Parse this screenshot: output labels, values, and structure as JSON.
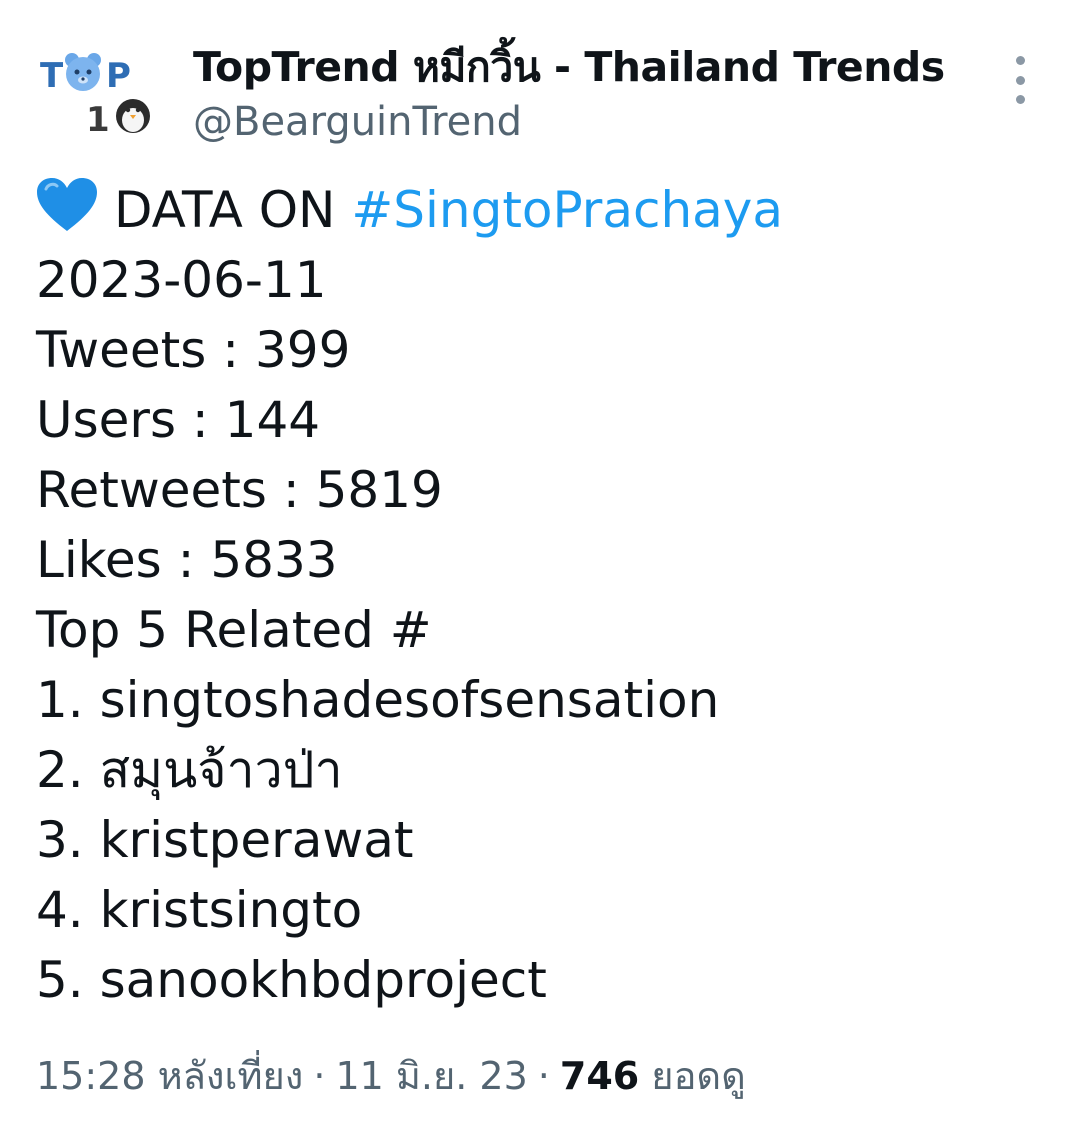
{
  "author": {
    "display_name": "TopTrend หมีกวิ้น - Thailand Trends",
    "handle": "@BearguinTrend",
    "avatar_text": "TOP 10",
    "avatar_icon": "bear-penguin-logo"
  },
  "tweet": {
    "heart_icon": "blue-heart-emoji",
    "lead_text": "DATA ON",
    "hashtag": "#SingtoPrachaya",
    "lines": [
      "2023-06-11",
      "Tweets : 399",
      "Users : 144",
      "Retweets : 5819",
      "Likes : 5833",
      "Top 5 Related #",
      "1. singtoshadesofsensation",
      "2. สมุนจ้าวป่า",
      "3. kristperawat",
      "4. kristsingto",
      "5. sanookhbdproject"
    ]
  },
  "meta": {
    "time": "15:28 หลังเที่ยง",
    "separator": "·",
    "date": "11 มิ.ย. 23",
    "views_count": "746",
    "views_label": "ยอดดู"
  },
  "colors": {
    "link": "#1d9bf0",
    "secondary_text": "#536471",
    "primary_text": "#0f1419"
  }
}
